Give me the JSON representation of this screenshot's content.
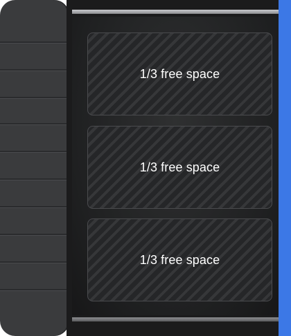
{
  "slots": [
    {
      "label": "1/3 free space"
    },
    {
      "label": "1/3 free space"
    },
    {
      "label": "1/3 free space"
    }
  ],
  "colors": {
    "accent": "#3c78e6",
    "shelf_background": "#1b1b1c",
    "panel_background": "#3a3b3d",
    "slot_border": "#4a4b4e",
    "label_text": "#ffffff"
  }
}
